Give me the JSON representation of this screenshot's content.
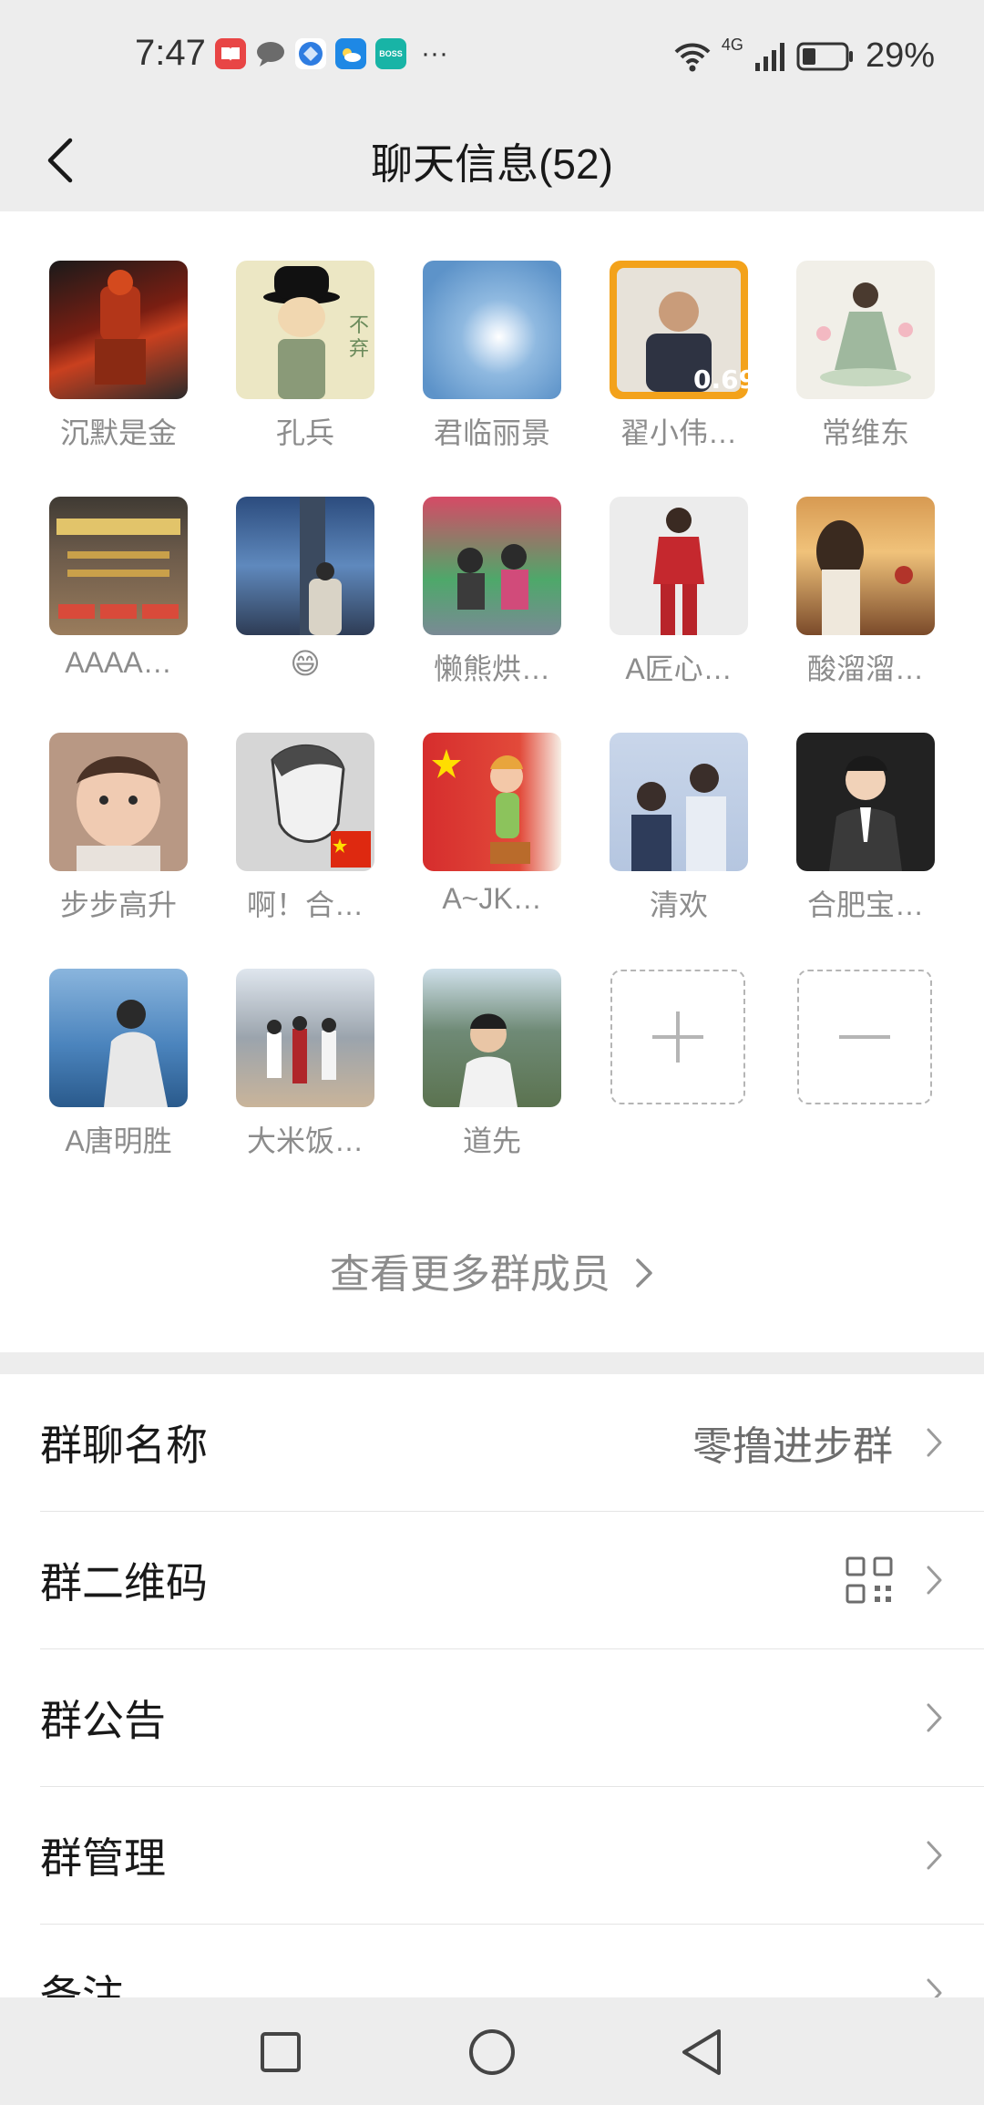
{
  "status_bar": {
    "time": "7:47",
    "apps": [
      {
        "icon": "book-app-icon",
        "color": "#e84545",
        "label": ""
      },
      {
        "icon": "chat-bubble-icon",
        "color": "#6b6b6b",
        "label": ""
      },
      {
        "icon": "browser-icon",
        "color": "#2f7de1",
        "label": ""
      },
      {
        "icon": "weather-app-icon",
        "color": "#1e88e5",
        "label": ""
      },
      {
        "icon": "boss-app-icon",
        "color": "#18b4a6",
        "label": "BOSS"
      }
    ],
    "more": "···",
    "network": "4G",
    "battery": "29%"
  },
  "header": {
    "title": "聊天信息(52)"
  },
  "members": [
    {
      "name": "沉默是金",
      "avatar_color": "#7a1e12"
    },
    {
      "name": "孔兵",
      "avatar_color": "#ece7c4"
    },
    {
      "name": "君临丽景",
      "avatar_color": "#6fa2cf"
    },
    {
      "name": "翟小伟…",
      "avatar_color": "#f3a21b"
    },
    {
      "name": "常维东",
      "avatar_color": "#d9d6cb"
    },
    {
      "name": "AAAA…",
      "avatar_color": "#6b5a4a"
    },
    {
      "name": "😄",
      "avatar_color": "#3b5c8c"
    },
    {
      "name": "懒熊烘…",
      "avatar_color": "#c84a5a"
    },
    {
      "name": "A匠心…",
      "avatar_color": "#e9e9e9"
    },
    {
      "name": "酸溜溜…",
      "avatar_color": "#c88a4b"
    },
    {
      "name": "步步高升",
      "avatar_color": "#b89884"
    },
    {
      "name": "啊！合…",
      "avatar_color": "#d6d6d6"
    },
    {
      "name": "A~JK…",
      "avatar_color": "#d62d2d"
    },
    {
      "name": "清欢",
      "avatar_color": "#b5c6e0"
    },
    {
      "name": "合肥宝…",
      "avatar_color": "#2a2a2a"
    },
    {
      "name": "A唐明胜",
      "avatar_color": "#3d6da3"
    },
    {
      "name": "大米饭…",
      "avatar_color": "#9ba4ad"
    },
    {
      "name": "道先",
      "avatar_color": "#6f8a76"
    }
  ],
  "actions": {
    "add": "+",
    "remove": "−"
  },
  "view_more": "查看更多群成员",
  "settings": {
    "group_name": {
      "label": "群聊名称",
      "value": "零撸进步群"
    },
    "qr_code": {
      "label": "群二维码"
    },
    "announcement": {
      "label": "群公告"
    },
    "management": {
      "label": "群管理"
    },
    "remark": {
      "label": "备注"
    }
  },
  "colors": {
    "page_bg": "#ededed",
    "panel_bg": "#ffffff",
    "secondary_text": "#8c8c8c"
  }
}
